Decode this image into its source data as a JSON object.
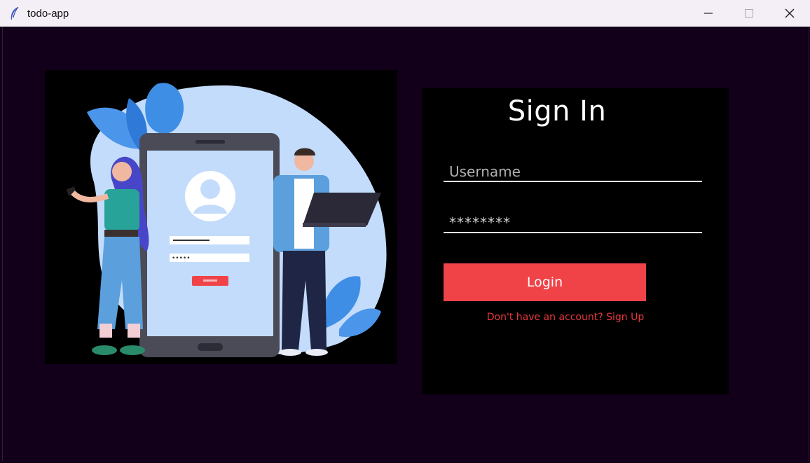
{
  "window": {
    "title": "todo-app",
    "icon": "feather-icon"
  },
  "controls": {
    "minimize": "minimize-icon",
    "maximize": "maximize-icon",
    "close": "close-icon"
  },
  "form": {
    "heading": "Sign In",
    "username_placeholder": "Username",
    "password_value": "********",
    "login_label": "Login",
    "signup_prompt": "Don't have an account? Sign Up"
  },
  "colors": {
    "background": "#12001a",
    "panel": "#000000",
    "accent": "#ef4348",
    "link": "#e8383d"
  }
}
